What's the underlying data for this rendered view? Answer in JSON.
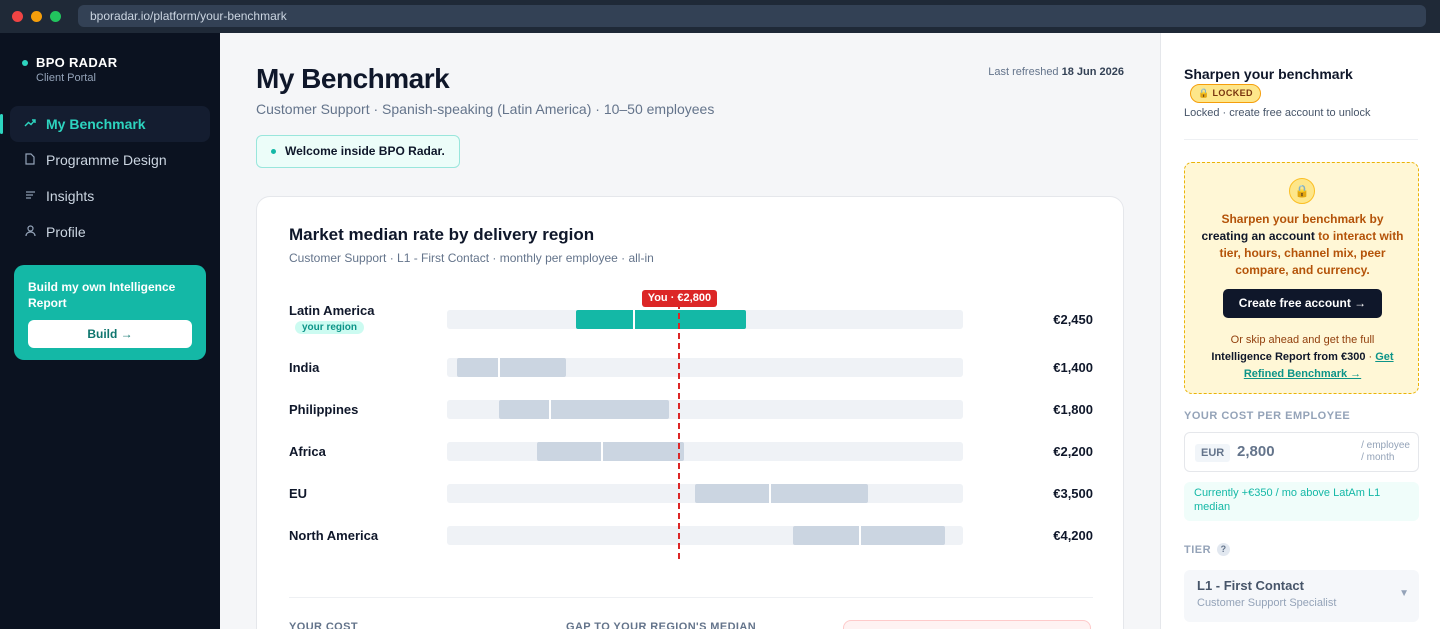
{
  "browser": {
    "url": "bporadar.io/platform/your-benchmark"
  },
  "sidebar": {
    "brand": "BPO RADAR",
    "brand_sub": "Client Portal",
    "items": [
      {
        "label": "My Benchmark",
        "icon": "trend-icon",
        "active": true
      },
      {
        "label": "Programme Design",
        "icon": "document-icon",
        "active": false
      },
      {
        "label": "Insights",
        "icon": "list-icon",
        "active": false
      },
      {
        "label": "Profile",
        "icon": "user-icon",
        "active": false
      }
    ],
    "promo": {
      "title": "Build my own Intelligence Report",
      "button": "Build →"
    }
  },
  "main": {
    "title": "My Benchmark",
    "subtitle": "Customer Support · Spanish-speaking (Latin America) · 10–50 employees",
    "refreshed_label": "Last refreshed",
    "refreshed_date": "18 Jun 2026",
    "welcome": "Welcome inside BPO Radar.",
    "card_title": "Market median rate by delivery region",
    "card_sub": "Customer Support · L1 - First Contact · monthly per employee · all-in",
    "you_badge": "You · €2,800",
    "region_tag": "your region",
    "footer": {
      "your_cost": "YOUR COST",
      "gap": "GAP TO YOUR REGION'S MEDIAN"
    }
  },
  "chart_data": {
    "type": "bar",
    "currency": "EUR",
    "scale": [
      1000,
      5000
    ],
    "you": 2800,
    "rows": [
      {
        "region": "Latin America",
        "median": 2450,
        "median_label": "€2,450",
        "low": 2000,
        "high": 3320,
        "yours": true
      },
      {
        "region": "India",
        "median": 1400,
        "median_label": "€1,400",
        "low": 1080,
        "high": 1920
      },
      {
        "region": "Philippines",
        "median": 1800,
        "median_label": "€1,800",
        "low": 1400,
        "high": 2720
      },
      {
        "region": "Africa",
        "median": 2200,
        "median_label": "€2,200",
        "low": 1700,
        "high": 2840
      },
      {
        "region": "EU",
        "median": 3500,
        "median_label": "€3,500",
        "low": 2920,
        "high": 4260
      },
      {
        "region": "North America",
        "median": 4200,
        "median_label": "€4,200",
        "low": 3680,
        "high": 4860
      }
    ]
  },
  "right_panel": {
    "title": "Sharpen your benchmark",
    "locked_badge": "LOCKED",
    "locked_sub": "Locked · create free account to unlock",
    "lock_text_a": "Sharpen your benchmark by ",
    "lock_text_b": "creating an account",
    "lock_text_c": " to interact with tier, hours, channel mix, peer compare, and currency.",
    "create_button": "Create free account →",
    "skip_a": "Or skip ahead and get the full ",
    "skip_b": "Intelligence Report from €300",
    "skip_c": " · ",
    "skip_link": "Get Refined Benchmark →",
    "cost_label": "YOUR COST PER EMPLOYEE",
    "currency": "EUR",
    "cost_value": "2,800",
    "cost_unit_1": "/ employee",
    "cost_unit_2": "/ month",
    "cost_note": "Currently +€350 / mo above LatAm L1 median",
    "tier_label": "TIER",
    "tier_help": "?",
    "tier_value": "L1 - First Contact",
    "tier_sub": "Customer Support Specialist"
  }
}
